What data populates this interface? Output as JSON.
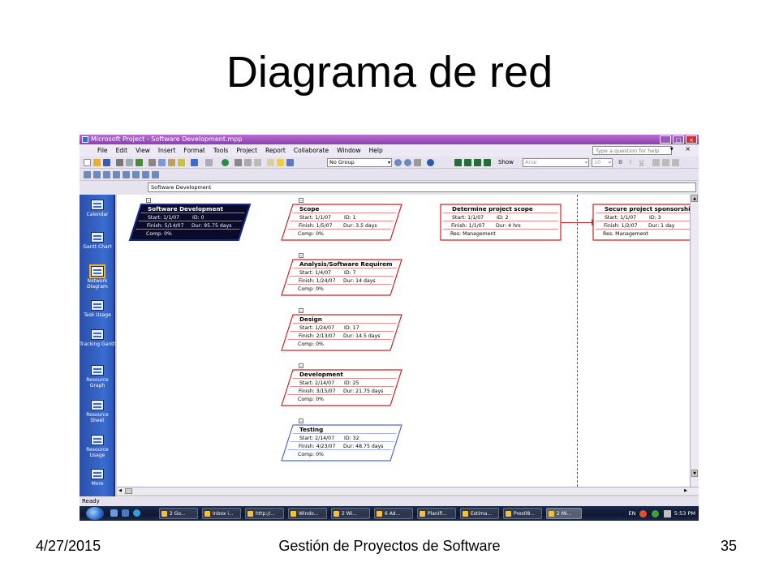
{
  "slide": {
    "title": "Diagrama de red",
    "footer_date": "4/27/2015",
    "footer_title": "Gestión de Proyectos de Software",
    "footer_page": "35"
  },
  "window": {
    "title": "Microsoft Project - Software Development.mpp",
    "controls": [
      "_",
      "□",
      "×"
    ]
  },
  "menu": {
    "items": [
      "File",
      "Edit",
      "View",
      "Insert",
      "Format",
      "Tools",
      "Project",
      "Report",
      "Collaborate",
      "Window",
      "Help"
    ],
    "help_placeholder": "Type a question for help",
    "right_controls": "▾ ×"
  },
  "toolbar": {
    "group_combo": "No Group",
    "show_label": "Show",
    "font_combo": "Arial",
    "size_combo": "10",
    "bold": "B",
    "italic": "I",
    "underline": "U"
  },
  "entry_bar": {
    "value": "Software Development"
  },
  "view_bar": {
    "items": [
      {
        "label": "Calendar",
        "icon": "calendar-icon"
      },
      {
        "label": "Gantt Chart",
        "icon": "gantt-chart-icon"
      },
      {
        "label": "Network Diagram",
        "icon": "network-diagram-icon",
        "active": true
      },
      {
        "label": "Task Usage",
        "icon": "task-usage-icon"
      },
      {
        "label": "Tracking Gantt",
        "icon": "tracking-gantt-icon"
      },
      {
        "label": "Resource Graph",
        "icon": "resource-graph-icon"
      },
      {
        "label": "Resource Sheet",
        "icon": "resource-sheet-icon"
      },
      {
        "label": "Resource Usage",
        "icon": "resource-usage-icon"
      },
      {
        "label": "More",
        "icon": "more-views-icon"
      }
    ]
  },
  "nodes": [
    {
      "title": "Software Development",
      "start": "Start:  1/1/07",
      "id": "ID:  0",
      "finish": "Finish:  5/14/07",
      "dur": "Dur:  95.75 days",
      "extra": "Comp: 0%",
      "style": "summary-selected",
      "border": "#1a2a8a"
    },
    {
      "title": "Scope",
      "start": "Start:  1/1/07",
      "id": "ID:  1",
      "finish": "Finish:  1/5/07",
      "dur": "Dur:  3.5 days",
      "extra": "Comp: 0%",
      "style": "summary-critical",
      "border": "#d02020"
    },
    {
      "title": "Analysis/Software Requirem",
      "start": "Start:  1/4/07",
      "id": "ID:  7",
      "finish": "Finish:  1/24/07",
      "dur": "Dur:  14 days",
      "extra": "Comp: 0%",
      "style": "summary-critical",
      "border": "#d02020"
    },
    {
      "title": "Design",
      "start": "Start:  1/24/07",
      "id": "ID:  17",
      "finish": "Finish:  2/13/07",
      "dur": "Dur:  14.5 days",
      "extra": "Comp: 0%",
      "style": "summary-critical",
      "border": "#d02020"
    },
    {
      "title": "Development",
      "start": "Start:  2/14/07",
      "id": "ID:  25",
      "finish": "Finish:  3/15/07",
      "dur": "Dur:  21.75 days",
      "extra": "Comp: 0%",
      "style": "summary-critical",
      "border": "#d02020"
    },
    {
      "title": "Testing",
      "start": "Start:  2/14/07",
      "id": "ID:  32",
      "finish": "Finish:  4/23/07",
      "dur": "Dur:  48.75 days",
      "extra": "Comp: 0%",
      "style": "summary-normal",
      "border": "#4a6ad0"
    },
    {
      "title": "Determine project scope",
      "start": "Start:  1/1/07",
      "id": "ID:  2",
      "finish": "Finish:  1/1/07",
      "dur": "Dur:  4 hrs",
      "extra": "Res:    Management",
      "style": "task-critical",
      "border": "#d02020"
    },
    {
      "title": "Secure project sponsorship",
      "start": "Start:  1/1/07",
      "id": "ID:  3",
      "finish": "Finish:  1/2/07",
      "dur": "Dur:  1 day",
      "extra": "Res:    Management",
      "style": "task-critical",
      "border": "#d02020"
    }
  ],
  "status": {
    "text": "Ready"
  },
  "taskbar": {
    "items": [
      "2 Go...",
      "Inbox i...",
      "http://...",
      "Windo...",
      "2 Wi...",
      "6 Ad...",
      "Planifi...",
      "Estima...",
      "Pres08...",
      "2 Mi..."
    ],
    "language": "EN",
    "clock": "5:53 PM"
  },
  "colors": {
    "critical": "#d02020",
    "normal": "#4a6ad0",
    "selected_fill": "#0a0a2a",
    "titlebar": "#9a4fc0",
    "view_bar": "#2f5fc4"
  }
}
